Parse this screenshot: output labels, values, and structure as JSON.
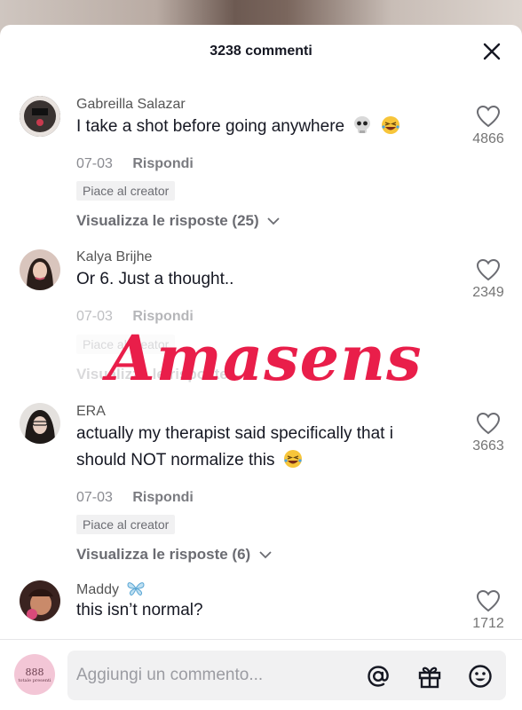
{
  "header": {
    "title": "3238 commenti",
    "close_icon": "close-icon"
  },
  "comments": [
    {
      "username": "Gabreilla Salazar",
      "text": "I take a shot before going anywhere",
      "emojis": [
        "skull-emoji",
        "laughing-emoji"
      ],
      "date": "07-03",
      "reply_label": "Rispondi",
      "badge": "Piace al creator",
      "view_replies": "Visualizza le risposte (25)",
      "likes": "4866"
    },
    {
      "username": "Kalya Brijhe",
      "text": "Or 6. Just a thought..",
      "date": "07-03",
      "reply_label": "Rispondi",
      "badge": "Piace al creator",
      "view_replies": "Visualizza le risposte",
      "likes": "2349"
    },
    {
      "username": "ERA",
      "text_line1": "actually my therapist said specifically that i",
      "text_line2": "should NOT normalize this",
      "emojis": [
        "laughing-emoji"
      ],
      "date": "07-03",
      "reply_label": "Rispondi",
      "badge": "Piace al creator",
      "view_replies": "Visualizza le risposte (6)",
      "likes": "3663"
    },
    {
      "username": "Maddy",
      "username_emoji": "butterfly-emoji",
      "text": "this isn’t normal?",
      "likes": "1712"
    }
  ],
  "watermark": "Amasens",
  "input": {
    "placeholder": "Aggiungi un commento...",
    "avatar_text": "888",
    "avatar_subtext": "totale presenti",
    "icons": [
      "at-mention-icon",
      "gift-icon",
      "emoji-icon"
    ]
  },
  "colors": {
    "watermark": "#e91e4a",
    "text": "#161823",
    "muted": "#8a8b91"
  }
}
